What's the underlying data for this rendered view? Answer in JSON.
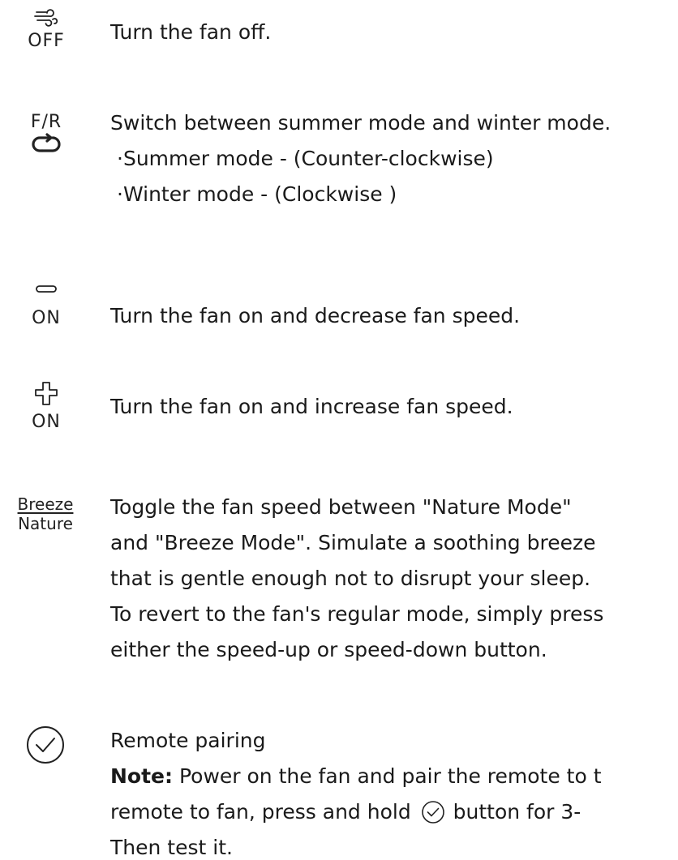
{
  "rows": {
    "off": {
      "icon_label": "OFF",
      "icon": "fan-wind-icon",
      "text": "Turn the fan off."
    },
    "fr": {
      "icon_label": "F/R",
      "icon": "reverse-loop-icon",
      "text": "Switch between summer mode and winter mode.",
      "bullets": [
        "·Summer mode - (Counter-clockwise)",
        "·Winter mode - (Clockwise )"
      ]
    },
    "minus": {
      "icon_label": "ON",
      "icon": "minus-icon",
      "text": "Turn the fan on and decrease fan speed."
    },
    "plus": {
      "icon_label": "ON",
      "icon": "plus-icon",
      "text": "Turn the fan on and increase fan speed."
    },
    "breeze": {
      "label_top": "Breeze",
      "label_bottom": "Nature",
      "lines": [
        "Toggle the fan speed between \"Nature Mode\"",
        "and \"Breeze Mode\". Simulate a soothing breeze",
        "that is gentle enough not to disrupt your sleep.",
        "To revert to the fan's regular mode, simply press",
        "either the speed-up or speed-down button."
      ]
    },
    "pairing": {
      "icon": "check-circle-icon",
      "title": "Remote pairing",
      "note_label": "Note:",
      "note_text": " Power on the fan and pair the remote to t",
      "line2_before": "remote to fan, press and hold ",
      "line2_after": "button for 3-",
      "line3": "Then test it."
    }
  },
  "colors": {
    "text": "#1a1a1a",
    "icon": "#222222"
  }
}
